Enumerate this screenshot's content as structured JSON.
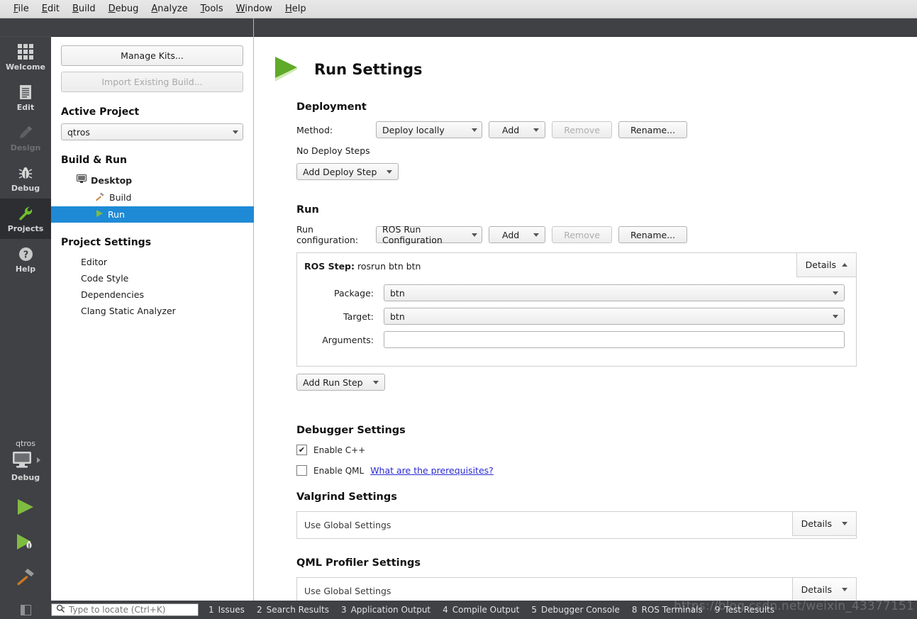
{
  "menubar": {
    "items": [
      {
        "label": "File",
        "accel": "F"
      },
      {
        "label": "Edit",
        "accel": "E"
      },
      {
        "label": "Build",
        "accel": "B"
      },
      {
        "label": "Debug",
        "accel": "D"
      },
      {
        "label": "Analyze",
        "accel": "A"
      },
      {
        "label": "Tools",
        "accel": "T"
      },
      {
        "label": "Window",
        "accel": "W"
      },
      {
        "label": "Help",
        "accel": "H"
      }
    ]
  },
  "modebar": {
    "items": [
      {
        "label": "Welcome",
        "icon": "grid-icon",
        "state": "normal"
      },
      {
        "label": "Edit",
        "icon": "document-icon",
        "state": "normal"
      },
      {
        "label": "Design",
        "icon": "pencil-icon",
        "state": "disabled"
      },
      {
        "label": "Debug",
        "icon": "bug-icon",
        "state": "normal"
      },
      {
        "label": "Projects",
        "icon": "wrench-icon",
        "state": "selected"
      },
      {
        "label": "Help",
        "icon": "question-icon",
        "state": "normal"
      }
    ],
    "target": {
      "kit_name": "qtros",
      "build_config": "Debug",
      "run_icon": "play-icon",
      "debug_icon": "debug-play-icon",
      "build_icon": "hammer-icon"
    }
  },
  "leftpanel": {
    "manage_kits_label": "Manage Kits...",
    "import_build_label": "Import Existing Build...",
    "active_project_title": "Active Project",
    "active_project_value": "qtros",
    "build_run_title": "Build & Run",
    "tree": {
      "kit_label": "Desktop",
      "children": [
        {
          "label": "Build",
          "selected": false
        },
        {
          "label": "Run",
          "selected": true
        }
      ]
    },
    "project_settings_title": "Project Settings",
    "project_settings_items": [
      "Editor",
      "Code Style",
      "Dependencies",
      "Clang Static Analyzer"
    ]
  },
  "main": {
    "page_title": "Run Settings",
    "deployment": {
      "title": "Deployment",
      "method_label": "Method:",
      "method_value": "Deploy locally",
      "add_label": "Add",
      "remove_label": "Remove",
      "rename_label": "Rename...",
      "no_steps_label": "No Deploy Steps",
      "add_step_label": "Add Deploy Step"
    },
    "run": {
      "title": "Run",
      "config_label": "Run configuration:",
      "config_value": "ROS Run Configuration",
      "add_label": "Add",
      "remove_label": "Remove",
      "rename_label": "Rename...",
      "step": {
        "title_prefix": "ROS Step:",
        "title_value": "rosrun btn btn",
        "details_label": "Details",
        "package_label": "Package:",
        "package_value": "btn",
        "target_label": "Target:",
        "target_value": "btn",
        "arguments_label": "Arguments:",
        "arguments_value": ""
      },
      "add_run_step_label": "Add Run Step"
    },
    "debugger": {
      "title": "Debugger Settings",
      "enable_cpp_label": "Enable C++",
      "enable_cpp_checked": true,
      "enable_qml_label": "Enable QML",
      "enable_qml_checked": false,
      "prerequisites_link": "What are the prerequisites?"
    },
    "valgrind": {
      "title": "Valgrind Settings",
      "global_label": "Use Global Settings",
      "details_label": "Details"
    },
    "qmlprofiler": {
      "title": "QML Profiler Settings",
      "global_label": "Use Global Settings",
      "details_label": "Details"
    }
  },
  "statusbar": {
    "locator_placeholder": "Type to locate (Ctrl+K)",
    "panes": [
      {
        "num": "1",
        "label": "Issues"
      },
      {
        "num": "2",
        "label": "Search Results"
      },
      {
        "num": "3",
        "label": "Application Output"
      },
      {
        "num": "4",
        "label": "Compile Output"
      },
      {
        "num": "5",
        "label": "Debugger Console"
      },
      {
        "num": "8",
        "label": "ROS Terminals"
      },
      {
        "num": "9",
        "label": "Test Results"
      }
    ],
    "watermark": "https://blog.csdn.net/weixin_43377151"
  },
  "colors": {
    "accent_selection": "#1e8ad6",
    "modebar_bg": "#3f4145",
    "mode_selected_bg": "#2c2e31",
    "run_green": "#5faa28",
    "link_blue": "#2a2ad0"
  }
}
